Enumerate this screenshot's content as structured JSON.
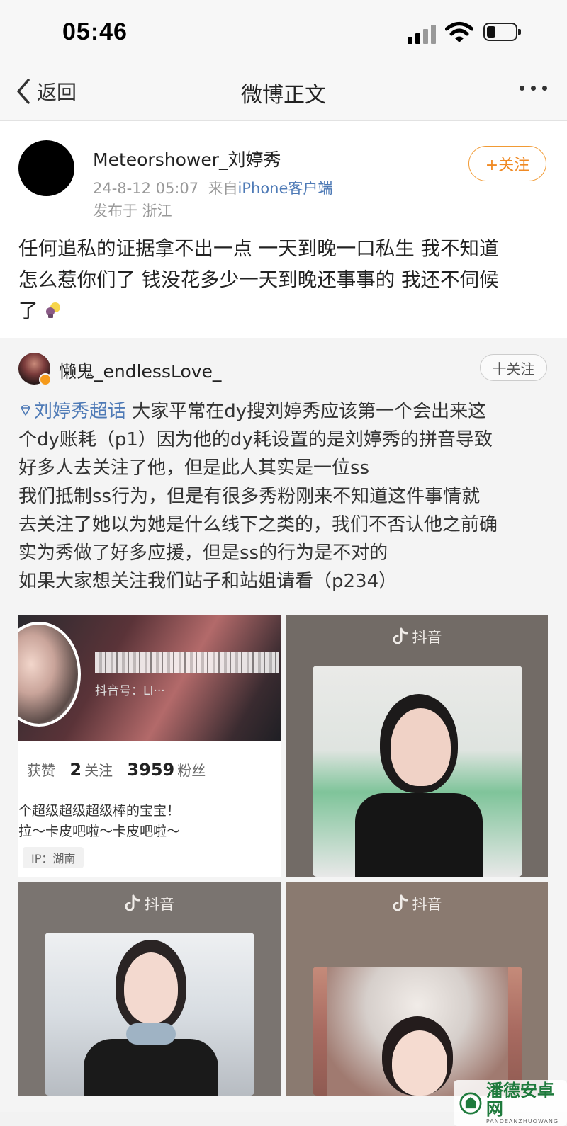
{
  "status": {
    "time": "05:46"
  },
  "nav": {
    "back_label": "返回",
    "title": "微博正文"
  },
  "post": {
    "author": "Meteorshower_刘婷秀",
    "date": "24-8-12 05:07",
    "from_prefix": "来自",
    "source": "iPhone客户端",
    "location": "发布于 浙江",
    "follow_label": "+关注",
    "lines": [
      "任何追私的证据拿不出一点 一天到晚一口私生 我不知道",
      "怎么惹你们了 钱没花多少一天到晚还事事的 我还不伺候",
      "了"
    ]
  },
  "repost": {
    "author": "懒鬼_endlessLove_",
    "follow_label": "十关注",
    "topic": "刘婷秀超话",
    "lines": [
      "大家平常在dy搜刘婷秀应该第一个会出来这",
      "个dy账耗（p1）因为他的dy耗设置的是刘婷秀的拼音导致",
      "好多人去关注了他，但是此人其实是一位ss",
      "我们抵制ss行为，但是有很多秀粉刚来不知道这件事情就",
      "去关注了她以为她是什么线下之类的，我们不否认他之前确",
      "实为秀做了好多应援，但是ss的行为是不对的",
      "如果大家想关注我们站子和站姐请看（p234）"
    ],
    "images": {
      "p1": {
        "dy_id_label": "抖音号：LI···",
        "likes_label": "获赞",
        "follow_count": "2",
        "follow_label": "关注",
        "fans_count": "3959",
        "fans_label": "粉丝",
        "bio_line1": "个超级超级超级棒的宝宝！",
        "bio_line2": "拉～卡皮吧啦～卡皮吧啦～",
        "ip": "IP：湖南"
      },
      "dy_brand": "抖音"
    }
  },
  "watermark": {
    "name": "潘德安卓网",
    "sub": "PANDEANZHUOWANG"
  }
}
